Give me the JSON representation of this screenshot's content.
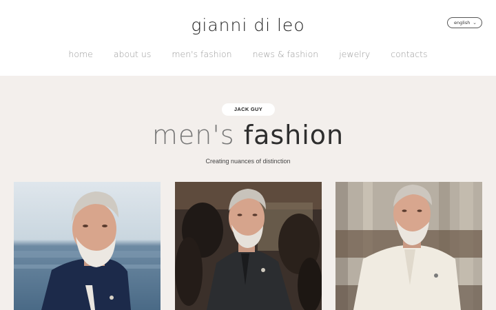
{
  "brand": {
    "logo_text": "gianni di leo"
  },
  "language": {
    "selected": "english",
    "chevron_icon": "chevron-down-icon"
  },
  "nav": {
    "items": [
      {
        "label": "home"
      },
      {
        "label": "about us"
      },
      {
        "label": "men's fashion"
      },
      {
        "label": "news & fashion"
      },
      {
        "label": "jewelry"
      },
      {
        "label": "contacts"
      }
    ]
  },
  "hero": {
    "tag": "JACK GUY",
    "title_light": "men's ",
    "title_heavy": "fashion",
    "subtitle": "Creating nuances of distinction"
  },
  "gallery": {
    "photos": [
      {
        "alt": "man in navy polo by the sea"
      },
      {
        "alt": "man in black polo in saddle room"
      },
      {
        "alt": "man in cream polo by wooden wall"
      }
    ]
  },
  "colors": {
    "page_bg": "#f3efec",
    "header_bg": "#ffffff",
    "nav_text": "#9a9a9a",
    "title_text": "#2e2e2e"
  }
}
